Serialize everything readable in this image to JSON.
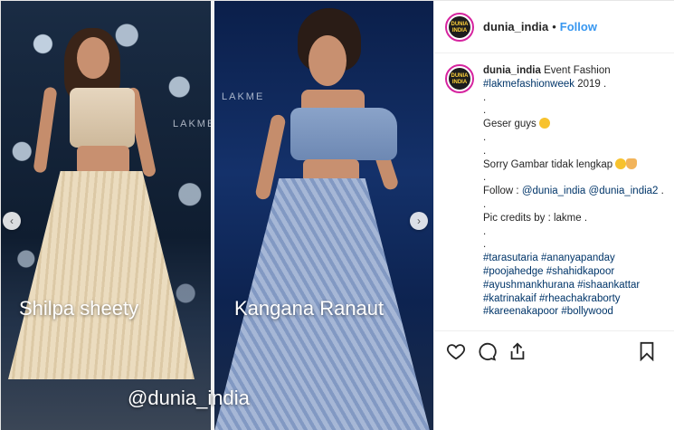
{
  "header": {
    "username": "dunia_india",
    "separator": "•",
    "follow_label": "Follow",
    "avatar_text": "DUNIA INDIA"
  },
  "media": {
    "left_caption": "Shilpa sheety",
    "right_caption": "Kangana Ranaut",
    "watermark": "@dunia_india",
    "prev_arrow": "‹",
    "next_arrow": "›"
  },
  "caption": {
    "username": "dunia_india",
    "line1_text": "Event Fashion",
    "line2_tag": "#lakmefashionweek",
    "line2_text": " 2019 .",
    "dot": ".",
    "geser": "Geser guys",
    "sorry": "Sorry Gambar tidak lengkap",
    "follow_prefix": "Follow :",
    "follow_tag1": "@dunia_india",
    "follow_tag2": "@dunia_india2",
    "follow_suffix": " .",
    "credits": "Pic credits by : lakme .",
    "hashtags": [
      [
        "#tarasutaria",
        "#ananyapanday"
      ],
      [
        "#poojahedge",
        "#shahidkapoor"
      ],
      [
        "#ayushmankhurana",
        "#ishaankattar"
      ],
      [
        "#katrinakaif",
        "#rheachakraborty"
      ],
      [
        "#kareenakapoor",
        "#bollywood"
      ]
    ]
  },
  "icons": {
    "heart": "heart-icon",
    "comment": "comment-icon",
    "share": "share-icon",
    "bookmark": "bookmark-icon"
  },
  "colors": {
    "follow": "#3897f0",
    "hashtag": "#003569",
    "avatar_ring": "#d6249f"
  }
}
